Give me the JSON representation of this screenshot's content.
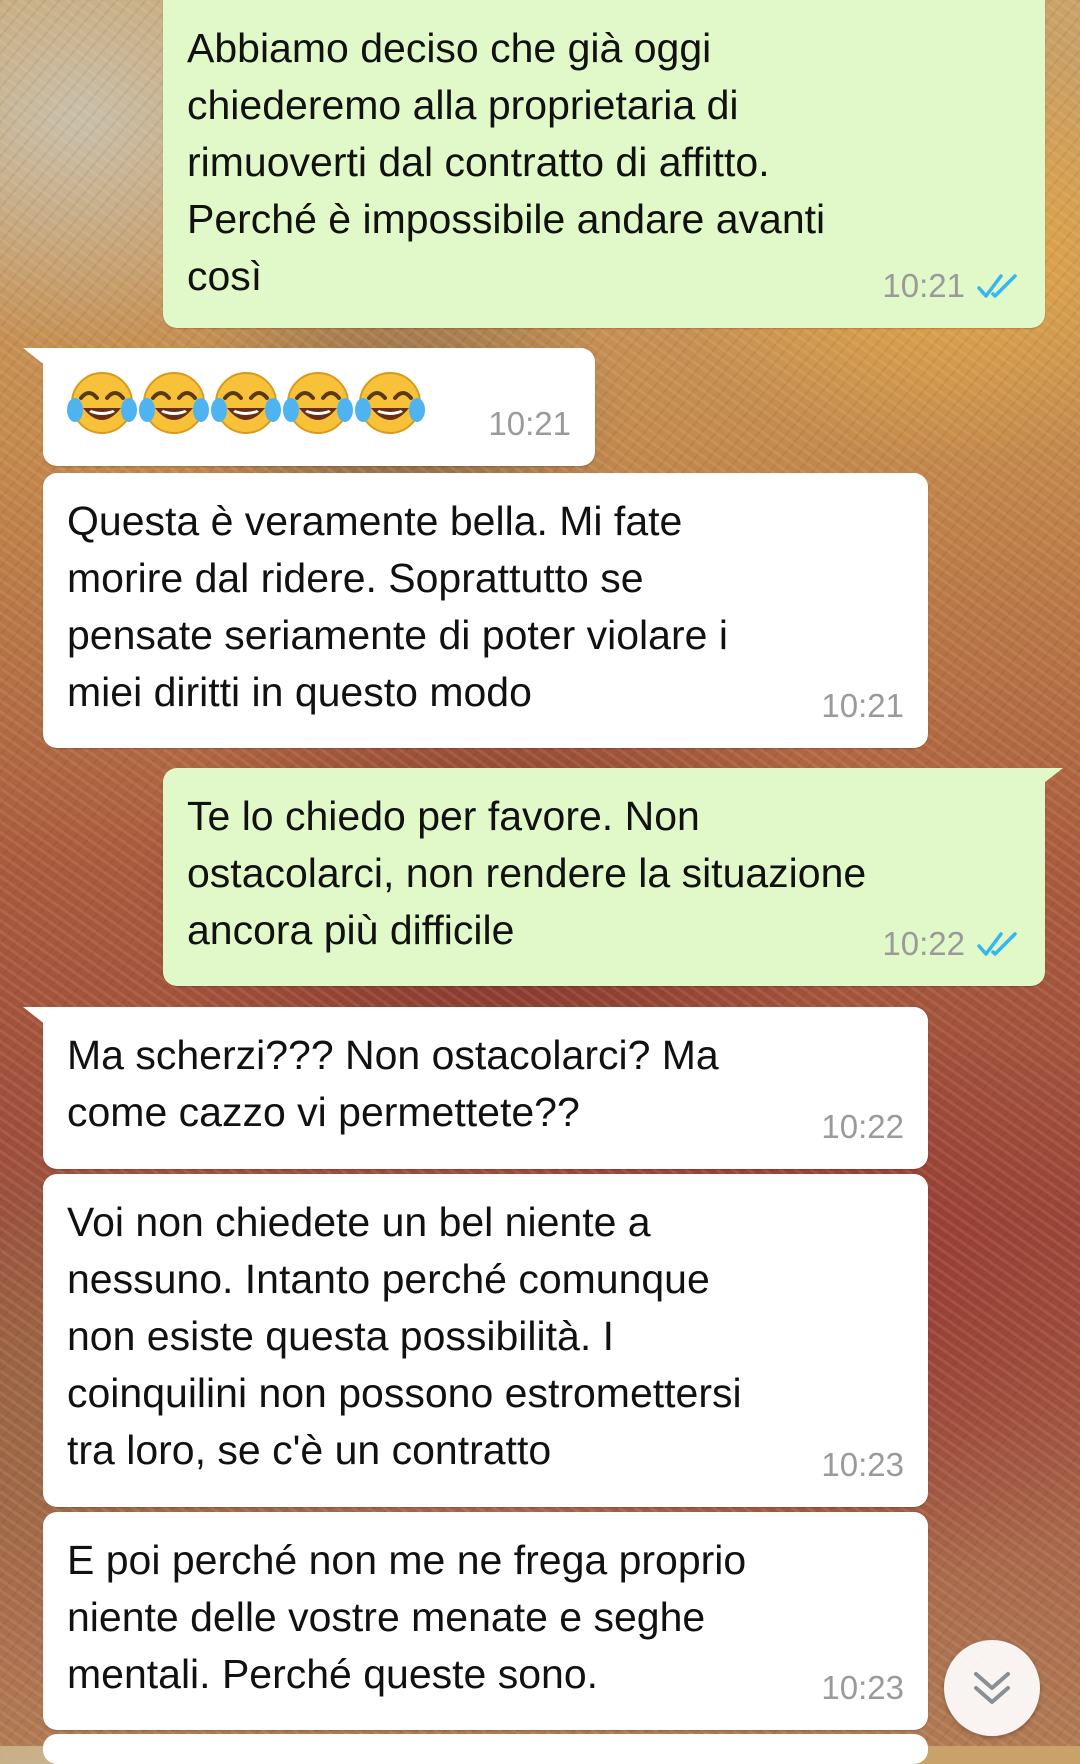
{
  "messages": [
    {
      "direction": "out",
      "text": "Abbiamo deciso che già oggi\nchiederemo alla proprietaria di\nrimuoverti dal contratto di affitto.\nPerché è impossibile andare avanti\ncosì",
      "time": "10:21",
      "status": "read"
    },
    {
      "direction": "in",
      "emoji": [
        "😂",
        "😂",
        "😂",
        "😂",
        "😂"
      ],
      "time": "10:21"
    },
    {
      "direction": "in",
      "text": "Questa è veramente bella. Mi fate\nmorire dal ridere. Soprattutto se\npensate seriamente di poter violare i\nmiei diritti in questo modo",
      "time": "10:21"
    },
    {
      "direction": "out",
      "text": "Te lo chiedo per favore. Non\nostacolarci, non rendere la situazione\nancora più difficile",
      "time": "10:22",
      "status": "read"
    },
    {
      "direction": "in",
      "text": "Ma scherzi??? Non ostacolarci? Ma\ncome cazzo vi permettete??",
      "time": "10:22"
    },
    {
      "direction": "in",
      "text": "Voi non chiedete un bel niente a\nnessuno. Intanto perché comunque\nnon esiste questa possibilità. I\ncoinquilini non possono estromettersi\ntra loro, se c'è un contratto",
      "time": "10:23"
    },
    {
      "direction": "in",
      "text": "E poi perché non me ne frega proprio\nniente delle vostre menate e seghe\nmentali. Perché queste sono.",
      "time": "10:23"
    }
  ],
  "colors": {
    "outgoing_bubble": "#e1f8c9",
    "incoming_bubble": "#ffffff",
    "read_ticks": "#34b7f1",
    "timestamp": "#9a9a9a"
  },
  "icons": {
    "read_receipt": "double-check-icon",
    "scroll_down": "chevron-double-down-icon",
    "emoji": "face-with-tears-of-joy"
  }
}
